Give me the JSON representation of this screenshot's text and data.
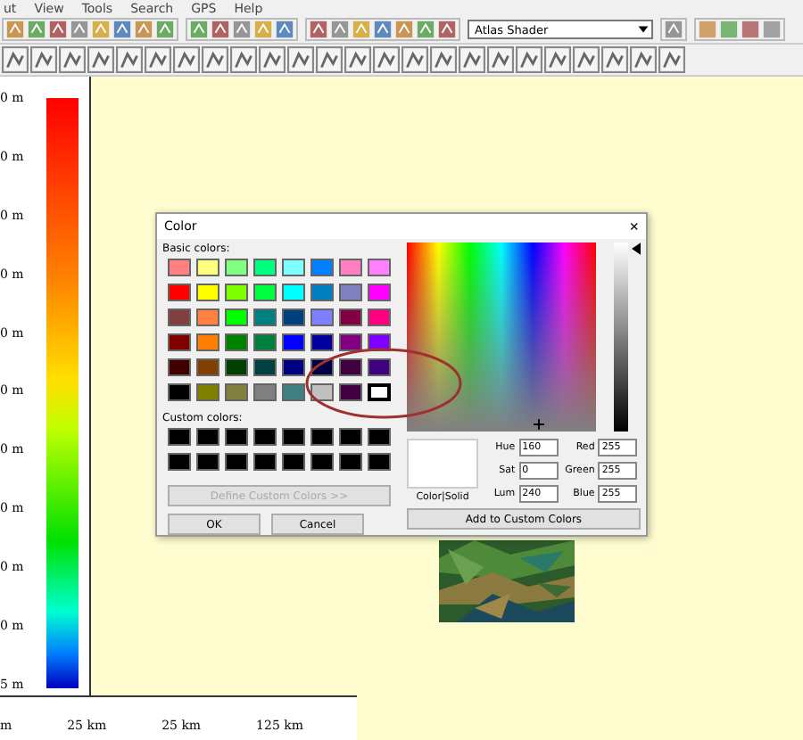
{
  "menu": [
    "ut",
    "View",
    "Tools",
    "Search",
    "GPS",
    "Help"
  ],
  "toolbar": {
    "shader_dropdown": "Atlas Shader"
  },
  "legend": {
    "labels": [
      "0 m",
      "0 m",
      "0 m",
      "0 m",
      "0 m",
      "0 m",
      "0 m",
      "0 m",
      "0 m",
      "0 m",
      "5 m"
    ]
  },
  "scale_bar": {
    "labels": [
      "m",
      "25 km",
      "25 km",
      "125 km"
    ]
  },
  "color_dialog": {
    "title": "Color",
    "close": "×",
    "basic_colors_label": "Basic colors:",
    "basic_colors": [
      {
        "color": "#ff8080",
        "selected": false
      },
      {
        "color": "#ffff80",
        "selected": false
      },
      {
        "color": "#80ff80",
        "selected": false
      },
      {
        "color": "#00ff80",
        "selected": false
      },
      {
        "color": "#80ffff",
        "selected": false
      },
      {
        "color": "#0080ff",
        "selected": false
      },
      {
        "color": "#ff80c0",
        "selected": false
      },
      {
        "color": "#ff80ff",
        "selected": false
      },
      {
        "color": "#ff0000",
        "selected": false
      },
      {
        "color": "#ffff00",
        "selected": false
      },
      {
        "color": "#80ff00",
        "selected": false
      },
      {
        "color": "#00ff40",
        "selected": false
      },
      {
        "color": "#00ffff",
        "selected": false
      },
      {
        "color": "#0080c0",
        "selected": false
      },
      {
        "color": "#8080c0",
        "selected": false
      },
      {
        "color": "#ff00ff",
        "selected": false
      },
      {
        "color": "#804040",
        "selected": false
      },
      {
        "color": "#ff8040",
        "selected": false
      },
      {
        "color": "#00ff00",
        "selected": false
      },
      {
        "color": "#008080",
        "selected": false
      },
      {
        "color": "#004080",
        "selected": false
      },
      {
        "color": "#8080ff",
        "selected": false
      },
      {
        "color": "#800040",
        "selected": false
      },
      {
        "color": "#ff0080",
        "selected": false
      },
      {
        "color": "#800000",
        "selected": false
      },
      {
        "color": "#ff8000",
        "selected": false
      },
      {
        "color": "#008000",
        "selected": false
      },
      {
        "color": "#008040",
        "selected": false
      },
      {
        "color": "#0000ff",
        "selected": false
      },
      {
        "color": "#0000a0",
        "selected": false
      },
      {
        "color": "#800080",
        "selected": false
      },
      {
        "color": "#8000ff",
        "selected": false
      },
      {
        "color": "#400000",
        "selected": false
      },
      {
        "color": "#804000",
        "selected": false
      },
      {
        "color": "#004000",
        "selected": false
      },
      {
        "color": "#004040",
        "selected": false
      },
      {
        "color": "#000080",
        "selected": false
      },
      {
        "color": "#000040",
        "selected": false
      },
      {
        "color": "#400040",
        "selected": false
      },
      {
        "color": "#400080",
        "selected": false
      },
      {
        "color": "#000000",
        "selected": false
      },
      {
        "color": "#808000",
        "selected": false
      },
      {
        "color": "#808040",
        "selected": false
      },
      {
        "color": "#808080",
        "selected": false
      },
      {
        "color": "#408080",
        "selected": false
      },
      {
        "color": "#c0c0c0",
        "selected": false
      },
      {
        "color": "#400040",
        "selected": false
      },
      {
        "color": "#ffffff",
        "selected": true
      }
    ],
    "custom_colors_label": "Custom colors:",
    "custom_colors": [
      {
        "color": "#000000"
      },
      {
        "color": "#000000"
      },
      {
        "color": "#000000"
      },
      {
        "color": "#000000"
      },
      {
        "color": "#000000"
      },
      {
        "color": "#000000"
      },
      {
        "color": "#000000"
      },
      {
        "color": "#000000"
      },
      {
        "color": "#000000"
      },
      {
        "color": "#000000"
      },
      {
        "color": "#000000"
      },
      {
        "color": "#000000"
      },
      {
        "color": "#000000"
      },
      {
        "color": "#000000"
      },
      {
        "color": "#000000"
      },
      {
        "color": "#000000"
      }
    ],
    "define_button": {
      "label": "Define Custom Colors >>",
      "disabled": true
    },
    "ok_button": "OK",
    "cancel_button": "Cancel",
    "luminance": {
      "level": 1
    },
    "preview_label": "Color|Solid",
    "fields": [
      {
        "label": "Hue",
        "value": "160"
      },
      {
        "label": "Red",
        "value": "255"
      },
      {
        "label": "Sat",
        "value": "0"
      },
      {
        "label": "Green",
        "value": "255"
      },
      {
        "label": "Lum",
        "value": "240"
      },
      {
        "label": "Blue",
        "value": "255"
      }
    ],
    "add_button": "Add to Custom Colors"
  }
}
